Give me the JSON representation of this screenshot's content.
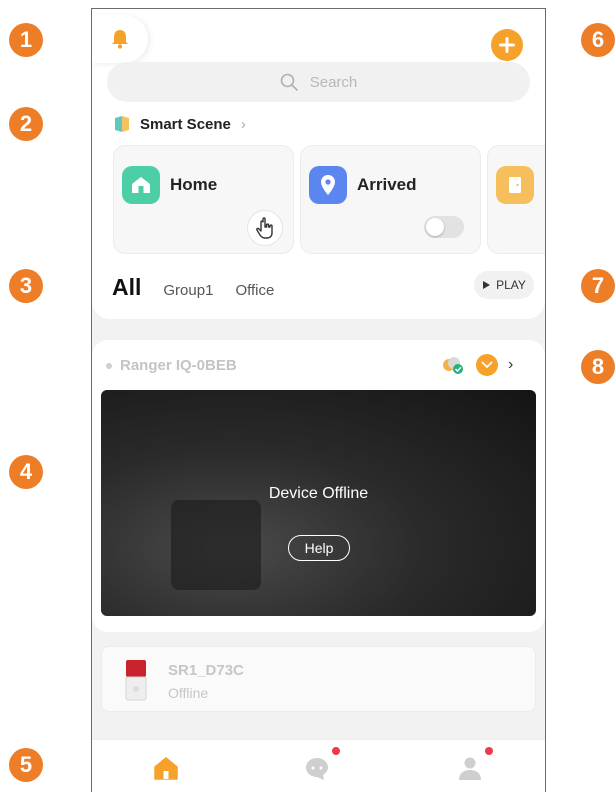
{
  "callouts": [
    "1",
    "2",
    "3",
    "4",
    "5",
    "6",
    "7",
    "8"
  ],
  "header": {
    "bell_icon": "bell-icon",
    "add_icon": "plus-icon",
    "add_label": "+"
  },
  "search": {
    "placeholder": "Search",
    "icon": "search-icon"
  },
  "smart_scene": {
    "title": "Smart Scene",
    "chevron": "›",
    "cards": [
      {
        "name": "Home",
        "icon": "home-icon",
        "icon_color": "#4ccfa7",
        "action": "tap"
      },
      {
        "name": "Arrived",
        "icon": "location-pin-icon",
        "icon_color": "#5b86f0",
        "action": "toggle",
        "enabled": false
      },
      {
        "name": "",
        "icon": "door-icon",
        "icon_color": "#f7be5c"
      }
    ]
  },
  "tabs": {
    "all": "All",
    "items": [
      "Group1",
      "Office"
    ],
    "play_label": "PLAY"
  },
  "camera": {
    "name": "Ranger IQ-0BEB",
    "message": "Device Offline",
    "help_label": "Help",
    "chevron": "›"
  },
  "sensor": {
    "name": "SR1_D73C",
    "status": "Offline"
  },
  "bottom_nav": {
    "items": [
      {
        "icon": "home-icon",
        "active": true,
        "badge": false
      },
      {
        "icon": "message-icon",
        "active": false,
        "badge": true
      },
      {
        "icon": "profile-icon",
        "active": false,
        "badge": true
      }
    ]
  },
  "colors": {
    "accent": "#f6a22a",
    "callout": "#ee7d28",
    "badge": "#f0384a"
  }
}
